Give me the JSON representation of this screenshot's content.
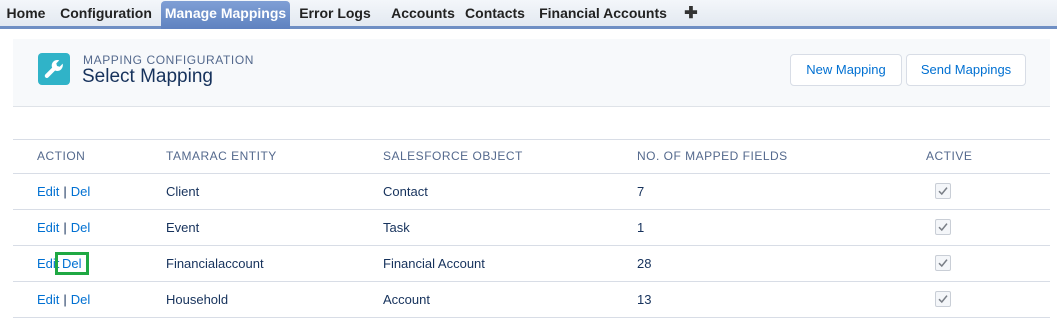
{
  "tabs": {
    "home": "Home",
    "configuration": "Configuration",
    "manage_mappings": "Manage Mappings",
    "error_logs": "Error Logs",
    "accounts": "Accounts",
    "contacts": "Contacts",
    "financial_accounts": "Financial Accounts",
    "add": "✚",
    "active_tab": "Manage Mappings"
  },
  "header": {
    "icon": "wrench-icon",
    "eyebrow": "MAPPING CONFIGURATION",
    "title": "Select Mapping",
    "new_mapping_label": "New Mapping",
    "send_mappings_label": "Send Mappings"
  },
  "table": {
    "columns": {
      "action": "ACTION",
      "entity": "TAMARAC ENTITY",
      "object": "SALESFORCE OBJECT",
      "fields": "NO. OF MAPPED FIELDS",
      "active": "ACTIVE"
    },
    "edit_label": "Edit",
    "separator": "|",
    "del_label": "Del",
    "rows": [
      {
        "entity": "Client",
        "object": "Contact",
        "fields": "7",
        "active": true
      },
      {
        "entity": "Event",
        "object": "Task",
        "fields": "1",
        "active": true
      },
      {
        "entity": "Financialaccount",
        "object": "Financial Account",
        "fields": "28",
        "active": true,
        "del_highlighted": true
      },
      {
        "entity": "Household",
        "object": "Account",
        "fields": "13",
        "active": true
      }
    ]
  },
  "colors": {
    "active_tab": "#6f8fc4",
    "link": "#0070d2",
    "header_icon": "#30b3c8",
    "highlight_box": "#1fa843"
  }
}
